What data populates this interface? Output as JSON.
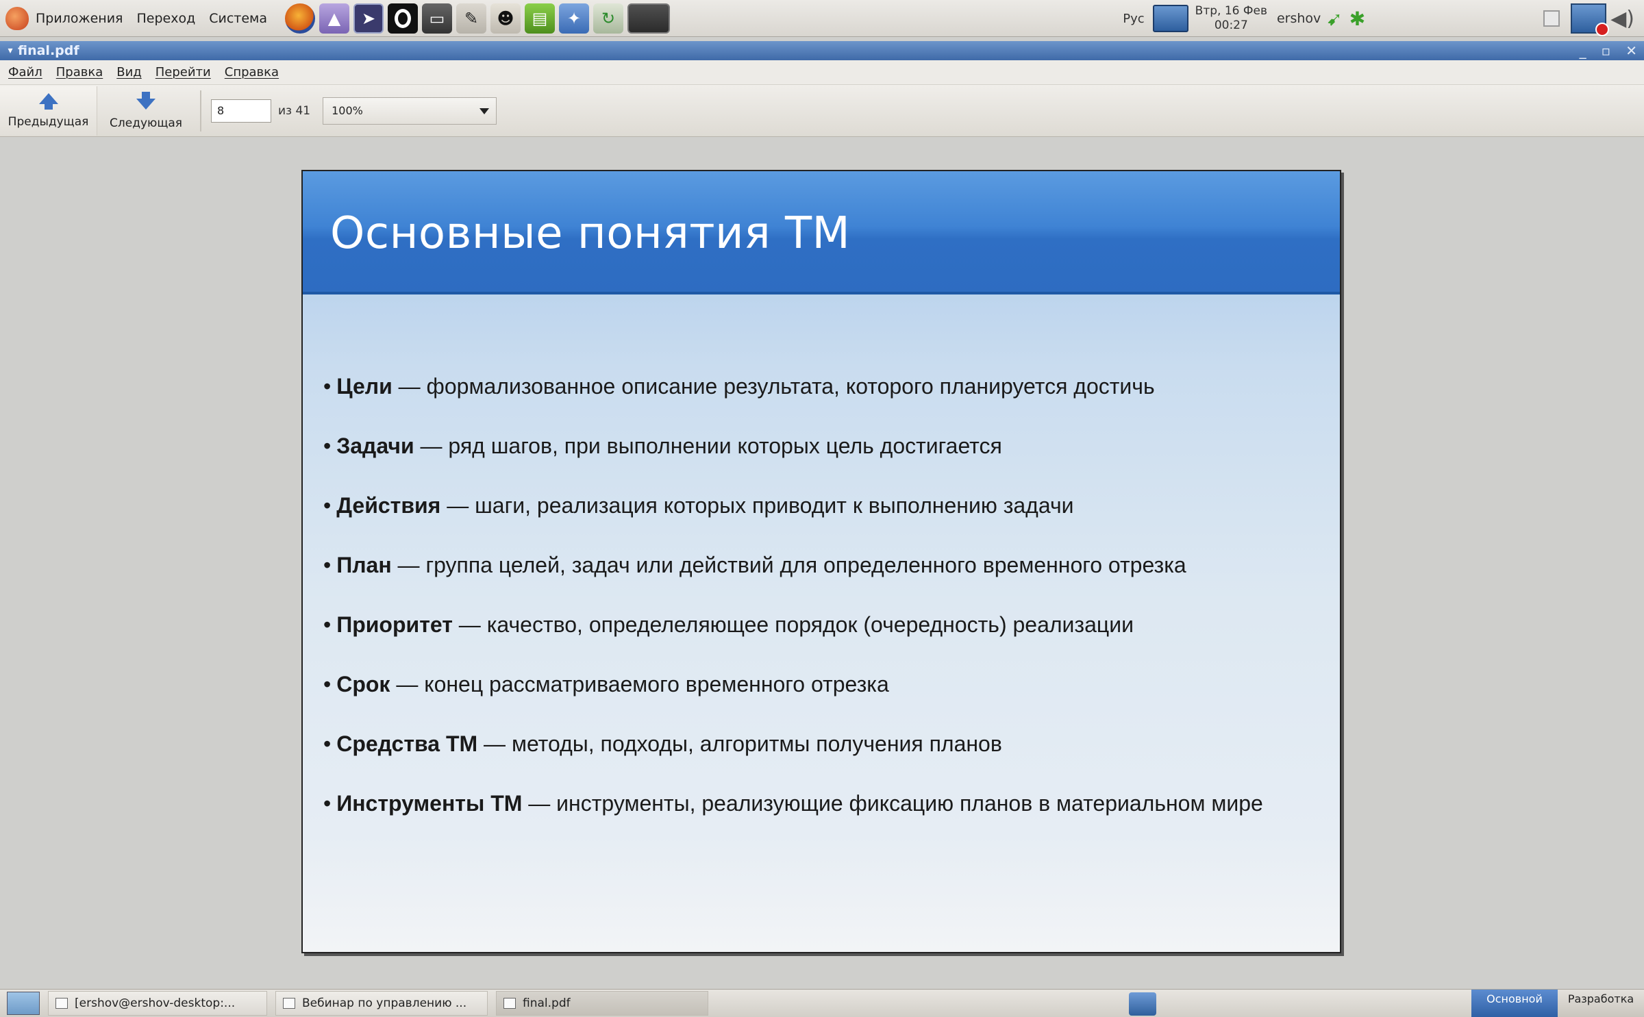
{
  "top_panel": {
    "menus": [
      "Приложения",
      "Переход",
      "Система"
    ],
    "launchers": [
      "firefox-icon",
      "wizard-icon",
      "cursor-icon",
      "opera-icon",
      "terminal-icon",
      "pencil-icon",
      "tux-icon",
      "green-app-icon",
      "puzzle-icon",
      "arrow-app-icon",
      "screen-icon"
    ],
    "keyboard_layout": "Рус",
    "clock_line1": "Втр, 16 Фев",
    "clock_line2": "00:27",
    "user": "ershov"
  },
  "window": {
    "title": "final.pdf"
  },
  "menubar": {
    "items": [
      "Файл",
      "Правка",
      "Вид",
      "Перейти",
      "Справка"
    ]
  },
  "toolbar": {
    "prev_label": "Предыдущая",
    "next_label": "Следующая",
    "page_value": "8",
    "page_of": "из 41",
    "zoom": "100%"
  },
  "slide": {
    "title": "Основные понятия ТМ",
    "bullets": [
      {
        "term": "Цели",
        "text": " — формализованное описание результата, которого планируется достичь"
      },
      {
        "term": "Задачи",
        "text": " — ряд шагов, при выполнении которых цель достигается"
      },
      {
        "term": "Действия",
        "text": " — шаги, реализация которых приводит к выполнению задачи"
      },
      {
        "term": "План",
        "text": " — группа целей, задач или действий для определенного временного отрезка"
      },
      {
        "term": "Приоритет",
        "text": " — качество, определеляющее порядок (очередность) реализации"
      },
      {
        "term": "Срок",
        "text": " — конец рассматриваемого временного отрезка"
      },
      {
        "term": "Средства ТМ",
        "text": "  — методы, подходы, алгоритмы получения планов"
      },
      {
        "term": "Инструменты ТМ",
        "text": " — инструменты, реализующие фиксацию планов в материальном мире"
      }
    ]
  },
  "taskbar": {
    "tasks": [
      "[ershov@ershov-desktop:...",
      "Вебинар по управлению ...",
      "final.pdf"
    ],
    "workspaces": [
      "Основной",
      "Разработка"
    ]
  },
  "colors": {
    "slide_header": "#3f83d4",
    "titlebar": "#4f78b6",
    "arrow_blue": "#3d72c2"
  }
}
